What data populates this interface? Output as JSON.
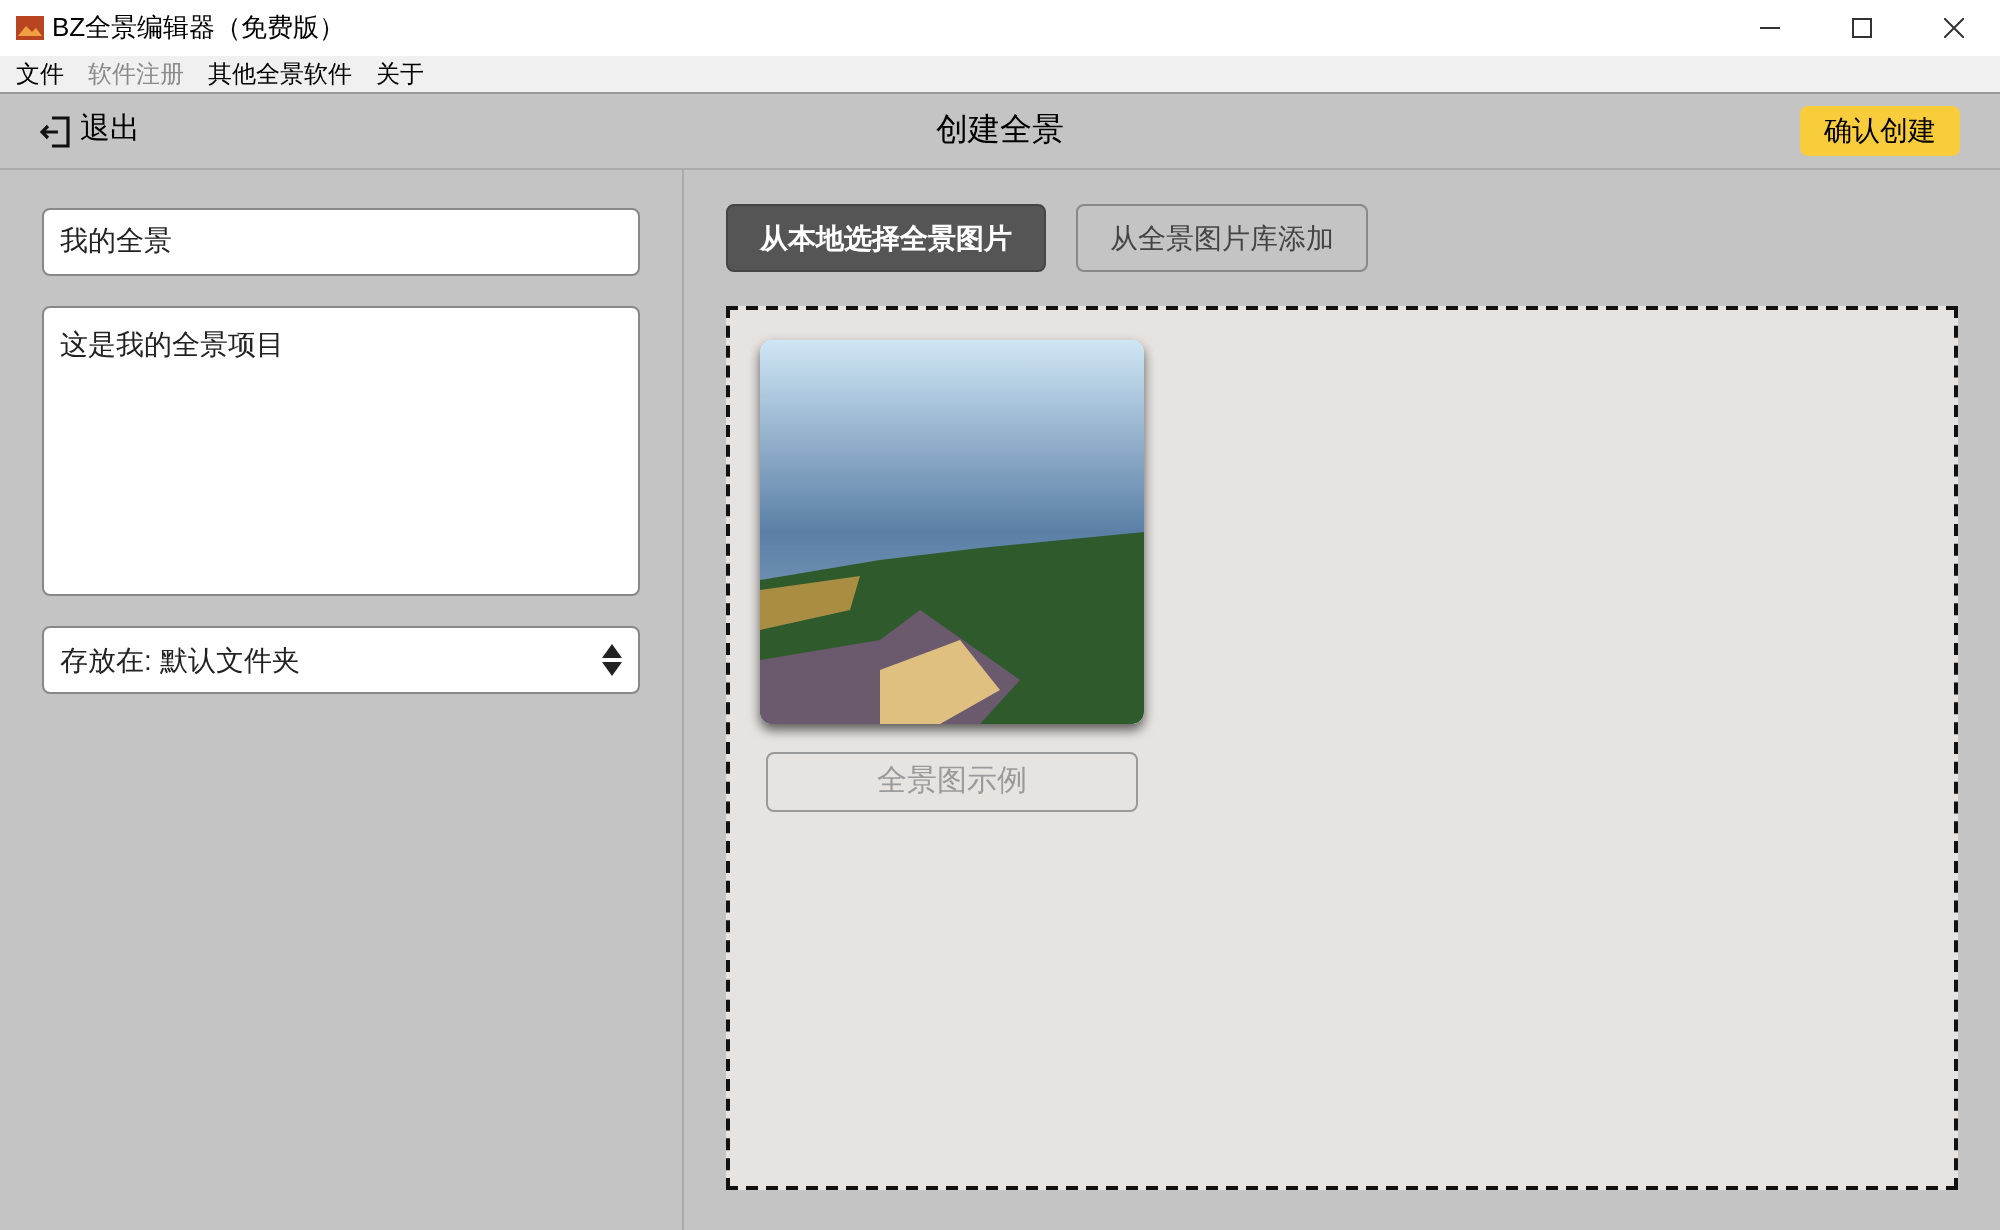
{
  "window": {
    "title": "BZ全景编辑器（免费版）"
  },
  "menu": [
    {
      "label": "文件",
      "disabled": false
    },
    {
      "label": "软件注册",
      "disabled": true
    },
    {
      "label": "其他全景软件",
      "disabled": false
    },
    {
      "label": "关于",
      "disabled": false
    }
  ],
  "toolbar": {
    "back": "退出",
    "title": "创建全景",
    "confirm": "确认创建"
  },
  "form": {
    "name": "我的全景",
    "description": "这是我的全景项目",
    "location": "存放在: 默认文件夹"
  },
  "sources": [
    {
      "label": "从本地选择全景图片",
      "selected": true
    },
    {
      "label": "从全景图片库添加",
      "selected": false
    }
  ],
  "images": [
    {
      "caption": "全景图示例",
      "disabled": true
    }
  ]
}
